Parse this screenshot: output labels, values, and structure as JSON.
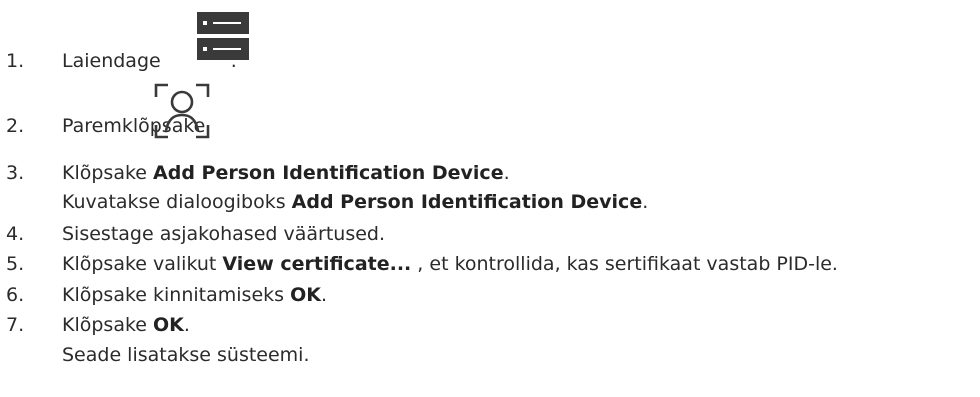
{
  "steps": [
    {
      "num": "1.",
      "before": "Laiendage",
      "after": "."
    },
    {
      "num": "2.",
      "before": "Paremklõpsake",
      "after": ""
    },
    {
      "num": "3.",
      "before": "Klõpsake ",
      "bold": "Add Person Identification Device",
      "after": "."
    },
    {
      "num": "4.",
      "before": "Sisestage asjakohased väärtused."
    },
    {
      "num": "5.",
      "before": "Klõpsake valikut ",
      "bold": "View certificate...",
      "after": " , et kontrollida, kas sertifikaat vastab PID-le."
    },
    {
      "num": "6.",
      "before": "Klõpsake kinnitamiseks ",
      "bold": "OK",
      "after": "."
    },
    {
      "num": "7.",
      "before": "Klõpsake ",
      "bold": "OK",
      "after": "."
    }
  ],
  "results": {
    "step3": {
      "before": "Kuvatakse dialoogiboks ",
      "bold": "Add Person Identification Device",
      "after": "."
    },
    "step7": {
      "before": "Seade lisatakse süsteemi."
    }
  },
  "icons": {
    "step1": "server-tree-icon",
    "step2": "person-identification-icon"
  },
  "colors": {
    "text": "#2b2b2b",
    "icon_dark": "#3a3a3a"
  }
}
